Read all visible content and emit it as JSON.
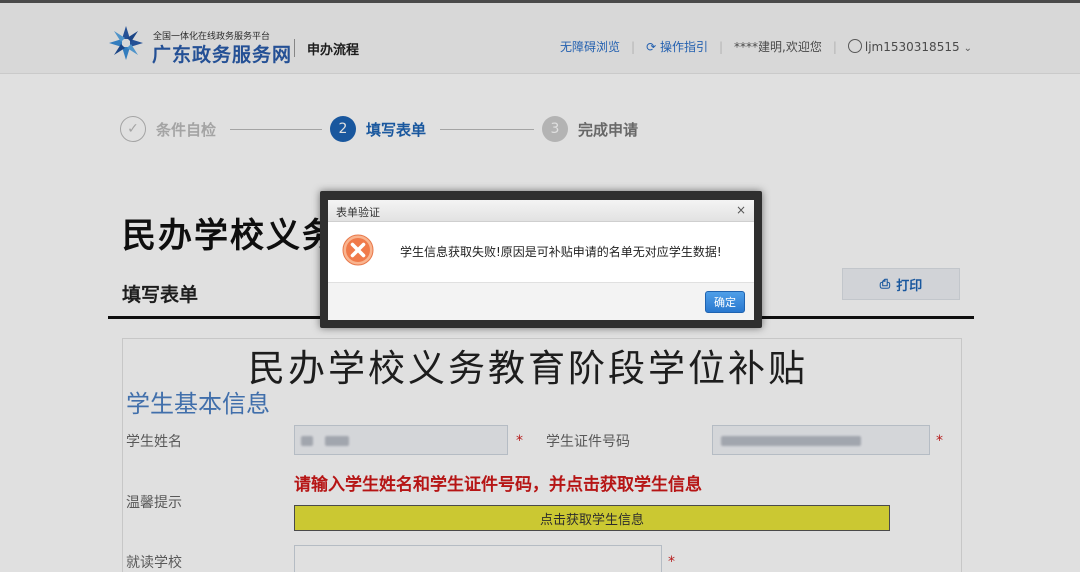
{
  "header": {
    "logo_small": "全国一体化在线政务服务平台",
    "logo_big": "广东政务服务网",
    "process_title": "申办流程",
    "nav": {
      "accessible": "无障碍浏览",
      "guide": "操作指引",
      "welcome": "****建明,欢迎您",
      "user": "ljm1530318515"
    }
  },
  "steps": [
    {
      "num": "✓",
      "label": "条件自检"
    },
    {
      "num": "2",
      "label": "填写表单"
    },
    {
      "num": "3",
      "label": "完成申请"
    }
  ],
  "page": {
    "title": "民办学校义务",
    "section_title": "填写表单",
    "print_label": "打印"
  },
  "form": {
    "title": "民办学校义务教育阶段学位补贴",
    "subtitle": "学生基本信息",
    "student_name_label": "学生姓名",
    "student_id_label": "学生证件号码",
    "tip_label": "温馨提示",
    "tip_text": "请输入学生姓名和学生证件号码，并点击获取学生信息",
    "fetch_button": "点击获取学生信息",
    "school_label": "就读学校",
    "required_mark": "*"
  },
  "dialog": {
    "title": "表单验证",
    "close": "×",
    "message": "学生信息获取失败!原因是可补贴申请的名单无对应学生数据!",
    "ok_label": "确定"
  },
  "colors": {
    "brand_blue": "#1d64b4",
    "link_blue": "#2a6fc9",
    "error_red": "#d01818",
    "button_yellow": "#e8e43a",
    "icon_orange": "#f07a4a"
  }
}
